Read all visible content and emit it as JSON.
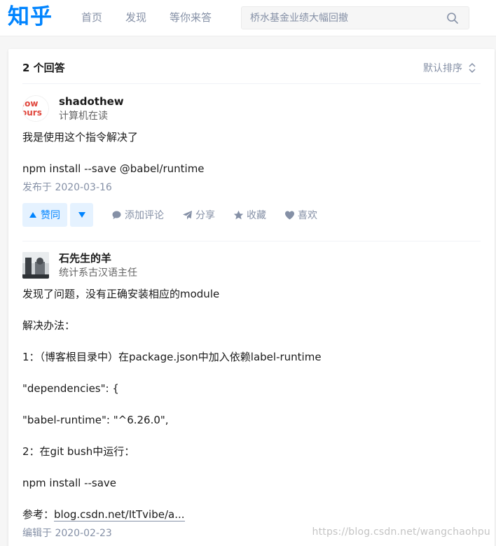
{
  "header": {
    "logo": "知乎",
    "nav": [
      "首页",
      "发现",
      "等你来答"
    ],
    "search_placeholder": "桥水基金业绩大幅回撤"
  },
  "answers_header": {
    "count": "2 个回答",
    "sort_label": "默认排序"
  },
  "answers": [
    {
      "author_name": "shadothew",
      "author_bio": "计算机在读",
      "paragraphs": [
        "我是使用这个指令解决了",
        "npm install --save @babel/runtime"
      ],
      "date": "发布于 2020-03-16",
      "actions": {
        "upvote": "赞同",
        "comment": "添加评论",
        "share": "分享",
        "collect": "收藏",
        "like": "喜欢"
      }
    },
    {
      "author_name": "石先生的羊",
      "author_bio": "统计系古汉语主任",
      "paragraphs": [
        "发现了问题，没有正确安装相应的module",
        "解决办法：",
        "1：（博客根目录中）在package.json中加入依赖label-runtime",
        "\"dependencies\": {",
        "\"babel-runtime\": \"^6.26.0\",",
        "2：在git bush中运行：",
        "npm install --save"
      ],
      "ref_prefix": "参考：",
      "ref_link": "blog.csdn.net/ItTvibe/a...",
      "date": "编辑于 2020-02-23"
    }
  ],
  "watermark": "https://blog.csdn.net/wangchaohpu",
  "colors": {
    "brand": "#0084ff",
    "muted": "#8590a6",
    "page_bg": "#f6f6f6"
  }
}
